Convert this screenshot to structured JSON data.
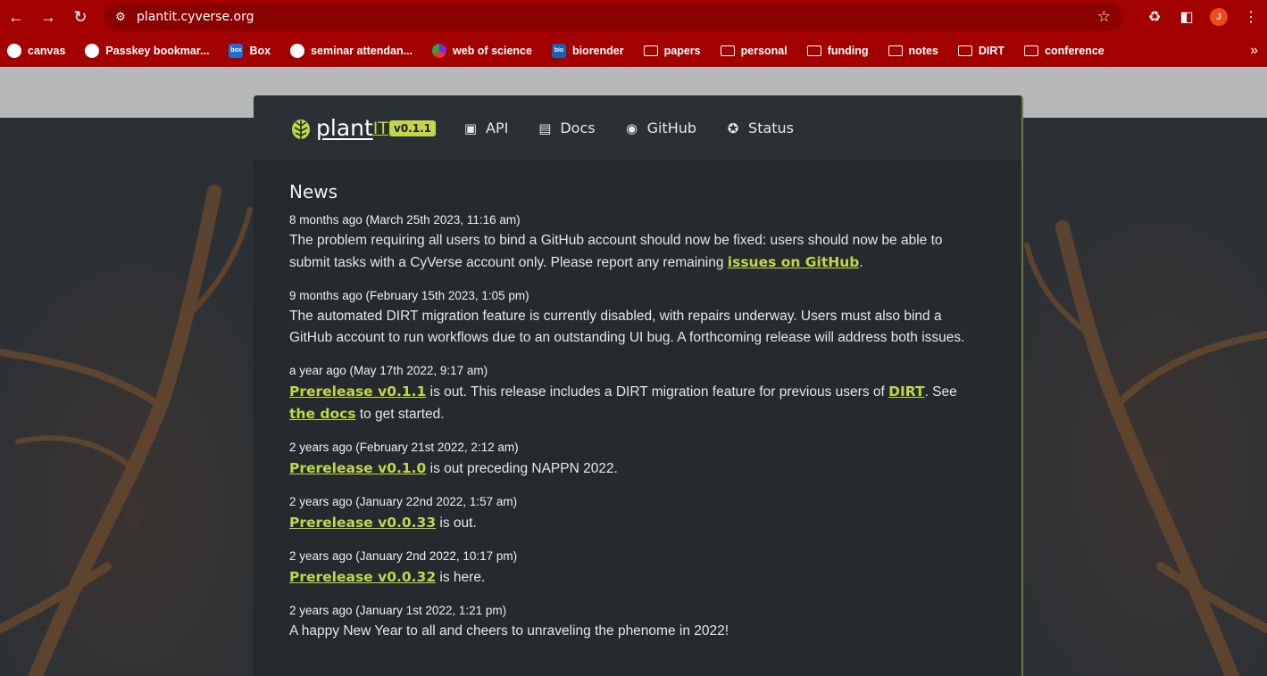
{
  "browser": {
    "url": "plantit.cyverse.org",
    "avatar_letter": "J",
    "accent": "#a30000"
  },
  "bookmarks": [
    {
      "label": "canvas",
      "icon": "canvas-icon"
    },
    {
      "label": "Passkey bookmar...",
      "icon": "globe-icon"
    },
    {
      "label": "Box",
      "icon": "box-icon",
      "glyph": "box"
    },
    {
      "label": "seminar attendan...",
      "icon": "seminar-icon"
    },
    {
      "label": "web of science",
      "icon": "wos-icon"
    },
    {
      "label": "biorender",
      "icon": "biorender-icon",
      "glyph": "bio"
    },
    {
      "label": "papers",
      "icon": "folder-icon"
    },
    {
      "label": "personal",
      "icon": "folder-icon"
    },
    {
      "label": "funding",
      "icon": "folder-icon"
    },
    {
      "label": "notes",
      "icon": "folder-icon"
    },
    {
      "label": "DIRT",
      "icon": "folder-icon"
    },
    {
      "label": "conference",
      "icon": "folder-icon"
    }
  ],
  "site": {
    "logo_plant": "plant",
    "logo_it": "IT",
    "version": "v0.1.1",
    "accent": "#c3d64a",
    "nav": [
      {
        "label": "API",
        "icon": "api-icon"
      },
      {
        "label": "Docs",
        "icon": "book-icon"
      },
      {
        "label": "GitHub",
        "icon": "github-icon"
      },
      {
        "label": "Status",
        "icon": "satellite-icon"
      }
    ]
  },
  "news": {
    "heading": "News",
    "items": [
      {
        "date": "8 months ago (March 25th 2023, 11:16 am)",
        "parts": [
          {
            "t": "The problem requiring all users to bind a GitHub account should now be fixed: users should now be able to submit tasks with a CyVerse account only. Please report any remaining "
          },
          {
            "t": "issues on GitHub",
            "link": true
          },
          {
            "t": "."
          }
        ]
      },
      {
        "date": "9 months ago (February 15th 2023, 1:05 pm)",
        "parts": [
          {
            "t": "The automated DIRT migration feature is currently disabled, with repairs underway. Users must also bind a GitHub account to run workflows due to an outstanding UI bug. A forthcoming release will address both issues."
          }
        ]
      },
      {
        "date": "a year ago (May 17th 2022, 9:17 am)",
        "parts": [
          {
            "t": "Prerelease v0.1.1",
            "link": true
          },
          {
            "t": " is out. This release includes a DIRT migration feature for previous users of "
          },
          {
            "t": "DIRT",
            "link": true
          },
          {
            "t": ". See "
          },
          {
            "t": "the docs",
            "link": true
          },
          {
            "t": " to get started."
          }
        ]
      },
      {
        "date": "2 years ago (February 21st 2022, 2:12 am)",
        "parts": [
          {
            "t": "Prerelease v0.1.0",
            "link": true
          },
          {
            "t": " is out preceding NAPPN 2022."
          }
        ]
      },
      {
        "date": "2 years ago (January 22nd 2022, 1:57 am)",
        "parts": [
          {
            "t": "Prerelease v0.0.33",
            "link": true
          },
          {
            "t": " is out."
          }
        ]
      },
      {
        "date": "2 years ago (January 2nd 2022, 10:17 pm)",
        "parts": [
          {
            "t": "Prerelease v0.0.32",
            "link": true
          },
          {
            "t": " is here."
          }
        ]
      },
      {
        "date": "2 years ago (January 1st 2022, 1:21 pm)",
        "parts": [
          {
            "t": "A happy New Year to all and cheers to unraveling the phenome in 2022!"
          }
        ]
      }
    ]
  }
}
